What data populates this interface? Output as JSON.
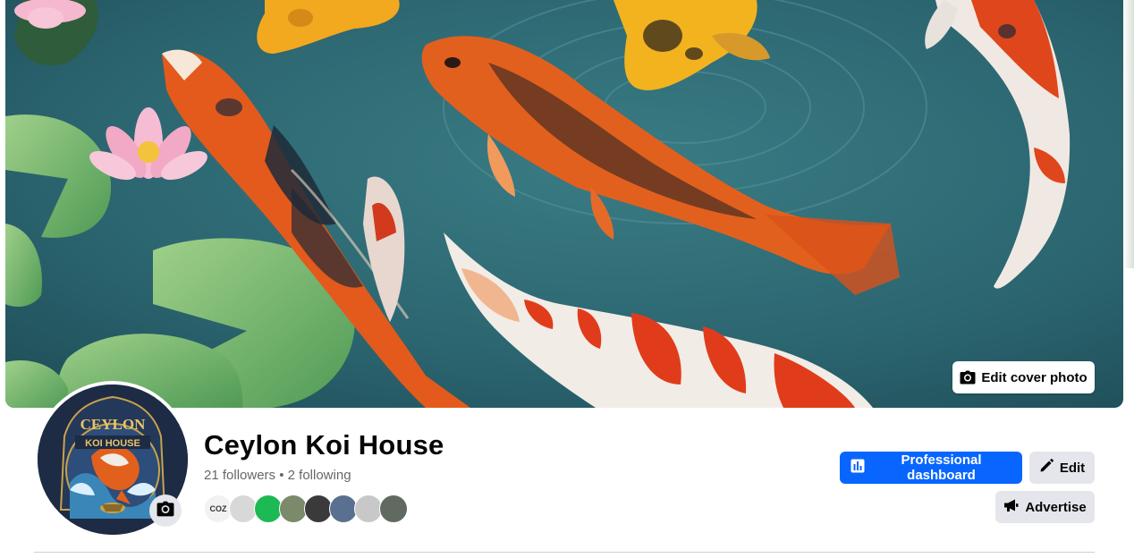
{
  "cover": {
    "edit_cover_label": "Edit cover photo"
  },
  "profile": {
    "logo_text_top": "CEYLON",
    "logo_text_bottom": "KOI HOUSE",
    "name": "Ceylon Koi House",
    "followers": "21 followers",
    "separator": "•",
    "following": "2 following"
  },
  "follower_avatars": [
    {
      "label": "COZ",
      "bg": "#f2f2f2",
      "fg": "#333333"
    },
    {
      "label": "",
      "bg": "#d8d8d8",
      "fg": "#333333"
    },
    {
      "label": "",
      "bg": "#1db954",
      "fg": "#ffffff"
    },
    {
      "label": "",
      "bg": "#7a8a6a",
      "fg": "#ffffff"
    },
    {
      "label": "",
      "bg": "#3a3a3a",
      "fg": "#ffffff"
    },
    {
      "label": "",
      "bg": "#5a7090",
      "fg": "#ffffff"
    },
    {
      "label": "",
      "bg": "#c8c8c8",
      "fg": "#333333"
    },
    {
      "label": "",
      "bg": "#606a60",
      "fg": "#ffffff"
    }
  ],
  "actions": {
    "professional_dashboard": "Professional dashboard",
    "edit": "Edit",
    "advertise": "Advertise"
  },
  "colors": {
    "primary_blue": "#0866ff",
    "secondary_gray": "#e4e6eb",
    "water": "#2f6a73"
  },
  "icons": {
    "cover_camera": "camera-icon",
    "avatar_camera": "camera-icon",
    "dashboard": "bar-chart-icon",
    "edit": "pencil-icon",
    "advertise": "megaphone-icon"
  }
}
